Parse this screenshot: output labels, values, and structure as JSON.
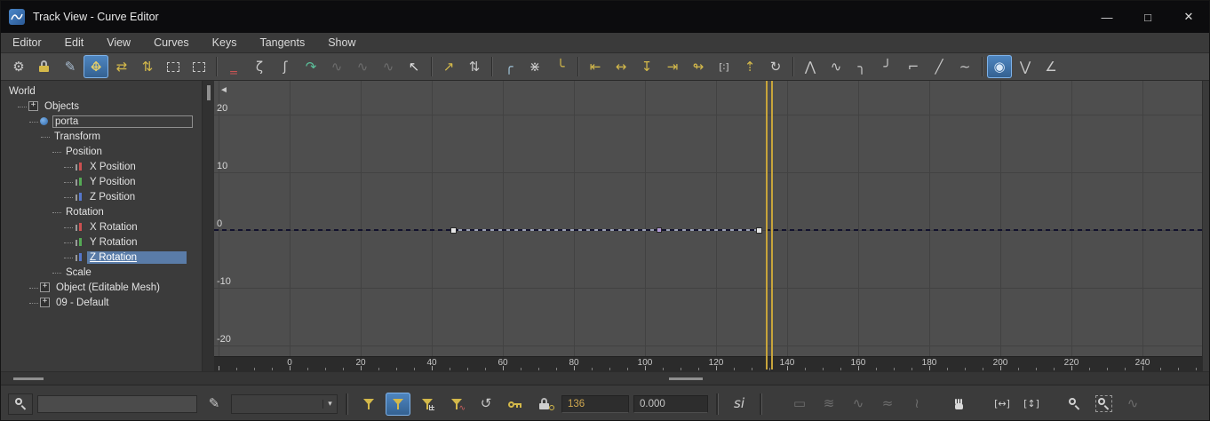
{
  "window": {
    "title": "Track View - Curve Editor",
    "controls": {
      "minimize": "—",
      "maximize": "□",
      "close": "✕"
    }
  },
  "menubar": {
    "items": [
      "Editor",
      "Edit",
      "View",
      "Curves",
      "Keys",
      "Tangents",
      "Show"
    ]
  },
  "toolbar": {
    "buttons": [
      {
        "name": "filters-icon",
        "glyph": "⚙",
        "color": "#c9c9c9"
      },
      {
        "name": "lock-selection-icon",
        "icon": "lock"
      },
      {
        "name": "draw-curves-icon",
        "glyph": "✎",
        "color": "#a9bdd1"
      },
      {
        "name": "move-keys-icon",
        "glyph": "↔",
        "glyph2": "↕",
        "color": "#e6d06a",
        "active": true
      },
      {
        "name": "move-keys-horizontal-icon",
        "glyph": "⇄",
        "color": "#d4b94a"
      },
      {
        "name": "move-keys-vertical-icon",
        "glyph": "⇅",
        "color": "#d4b94a"
      },
      {
        "name": "retime-tool-icon",
        "icon": "dashedbox"
      },
      {
        "name": "region-keys-tool-icon",
        "icon": "dashedbox"
      },
      {
        "sep": true
      },
      {
        "name": "reduce-keys-icon",
        "glyph": "‗",
        "color": "#c85454"
      },
      {
        "name": "spring-utility-icon",
        "glyph": "ζ",
        "color": "#c9c9c9"
      },
      {
        "name": "damper-utility-icon",
        "glyph": "ʃ",
        "color": "#c9c9c9"
      },
      {
        "name": "simplify-curve-icon",
        "glyph": "↷",
        "color": "#5bbf9a"
      },
      {
        "name": "show-buffer-curves-icon",
        "glyph": "∿",
        "disabled": true
      },
      {
        "name": "swap-buffer-curves-icon",
        "glyph": "∿",
        "disabled": true
      },
      {
        "name": "revert-buffer-curves-icon",
        "glyph": "∿",
        "disabled": true
      },
      {
        "name": "select-keys-cursor-icon",
        "glyph": "↖",
        "color": "#e0e0e0"
      },
      {
        "sep": true
      },
      {
        "name": "move-selected-keys-icon",
        "glyph": "↗",
        "color": "#d4b94a"
      },
      {
        "name": "nudge-keys-icon",
        "glyph": "⇅",
        "color": "#c9c9c9"
      },
      {
        "sep": true
      },
      {
        "name": "ease-tangent-icon",
        "glyph": "╭",
        "color": "#9fc3d8"
      },
      {
        "name": "break-tangents-icon",
        "glyph": "⋇",
        "color": "#c9c9c9"
      },
      {
        "name": "unify-tangents-icon",
        "glyph": "╰",
        "color": "#d4b94a"
      },
      {
        "sep": true
      },
      {
        "name": "align-keys-start-icon",
        "glyph": "⇤",
        "color": "#d4b94a"
      },
      {
        "name": "stretch-keys-icon",
        "glyph": "↔",
        "color": "#d4b94a"
      },
      {
        "name": "flatten-keys-icon",
        "glyph": "↧",
        "color": "#d4b94a"
      },
      {
        "name": "space-keys-icon",
        "glyph": "⇥",
        "color": "#d4b94a"
      },
      {
        "name": "offset-keys-icon",
        "glyph": "↬",
        "color": "#d4b94a"
      },
      {
        "name": "snap-frames-icon",
        "glyph": "[∶]",
        "color": "#c9c9c9",
        "small": true
      },
      {
        "name": "lift-keys-icon",
        "glyph": "⇡",
        "color": "#d4b94a"
      },
      {
        "name": "cycle-keys-icon",
        "glyph": "↻",
        "color": "#c9c9c9"
      },
      {
        "sep": true
      },
      {
        "name": "set-tangents-auto-icon",
        "glyph": "⋀",
        "color": "#c9c9c9"
      },
      {
        "name": "set-tangents-spline-icon",
        "glyph": "∿",
        "color": "#c9c9c9"
      },
      {
        "name": "set-tangents-fast-icon",
        "glyph": "╮",
        "color": "#c9c9c9"
      },
      {
        "name": "set-tangents-slow-icon",
        "glyph": "╯",
        "color": "#c9c9c9"
      },
      {
        "name": "set-tangents-step-icon",
        "glyph": "⌐",
        "color": "#c9c9c9"
      },
      {
        "name": "set-tangents-linear-icon",
        "glyph": "╱",
        "color": "#c9c9c9"
      },
      {
        "name": "set-tangents-smooth-icon",
        "glyph": "∼",
        "color": "#c9c9c9"
      },
      {
        "sep": true
      },
      {
        "name": "interactive-update-toggle-icon",
        "glyph": "◉",
        "color": "#d7e7f7",
        "active": true
      },
      {
        "name": "show-tangents-icon",
        "glyph": "⋁",
        "color": "#c9c9c9"
      },
      {
        "name": "show-end-tangents-icon",
        "glyph": "∠",
        "color": "#c9c9c9"
      }
    ]
  },
  "tree": {
    "axis_colors": {
      "x": "#cc5050",
      "y": "#55aa55",
      "z": "#5577cc"
    },
    "items": [
      {
        "label": "World",
        "depth": 0
      },
      {
        "label": "Objects",
        "depth": 1,
        "expander": true
      },
      {
        "label": "porta",
        "depth": 2,
        "dot": true,
        "boxed": true
      },
      {
        "label": "Transform",
        "depth": 3
      },
      {
        "label": "Position",
        "depth": 4
      },
      {
        "label": "X Position",
        "depth": 5,
        "axis": "x"
      },
      {
        "label": "Y Position",
        "depth": 5,
        "axis": "y"
      },
      {
        "label": "Z Position",
        "depth": 5,
        "axis": "z"
      },
      {
        "label": "Rotation",
        "depth": 4
      },
      {
        "label": "X Rotation",
        "depth": 5,
        "axis": "x"
      },
      {
        "label": "Y Rotation",
        "depth": 5,
        "axis": "y"
      },
      {
        "label": "Z Rotation",
        "depth": 5,
        "axis": "z",
        "selected": true
      },
      {
        "label": "Scale",
        "depth": 4
      },
      {
        "label": "Object (Editable Mesh)",
        "depth": 2,
        "expander": true
      },
      {
        "label": "09 - Default",
        "depth": 2,
        "expander": true
      }
    ]
  },
  "graph": {
    "collapse_arrow": "◄",
    "y_ticks": [
      20,
      10,
      0,
      -10,
      -20
    ],
    "x_ticks": [
      0,
      20,
      40,
      60,
      80,
      100,
      120,
      140,
      160,
      180,
      200,
      220,
      240
    ],
    "time_slider_frame": 136,
    "selected_track": "Z Rotation",
    "curve": {
      "style": "dashed",
      "color": "#12122e",
      "value": 0,
      "keys": [
        {
          "frame": 46,
          "value": 0,
          "state": "unselected"
        },
        {
          "frame": 104,
          "value": 0,
          "state": "soft"
        },
        {
          "frame": 132,
          "value": 0,
          "state": "unselected"
        }
      ]
    }
  },
  "bottombar": {
    "items": [
      {
        "type": "iconbox",
        "name": "zoom-selected-object-button",
        "icon": "magnifier"
      },
      {
        "type": "input",
        "name": "track-filter-input",
        "value": "",
        "width": 168
      },
      {
        "type": "icon",
        "name": "edit-track-set-icon",
        "glyph": "✎",
        "color": "#c9c9c9"
      },
      {
        "type": "select",
        "name": "track-set-dropdown",
        "value": "",
        "width": 118
      },
      {
        "type": "sep"
      },
      {
        "type": "icon",
        "name": "filter-selected-tracks-icon",
        "icon": "funnel"
      },
      {
        "type": "icon",
        "name": "filter-selected-objects-icon",
        "icon": "funnel",
        "active": true
      },
      {
        "type": "icon",
        "name": "filter-animated-tracks-icon",
        "icon": "funnel-grid"
      },
      {
        "type": "icon",
        "name": "filter-active-tracks-icon",
        "icon": "funnel-curve"
      },
      {
        "type": "icon",
        "name": "snap-frames-icon",
        "glyph": "↺",
        "color": "#c9c9c9"
      },
      {
        "type": "icon",
        "name": "show-keyable-tracks-icon",
        "icon": "key"
      },
      {
        "type": "icon",
        "name": "lock-selected-keys-icon",
        "icon": "keylock"
      },
      {
        "type": "field",
        "name": "key-time-field",
        "value": "136",
        "width": 62,
        "text_color": "#d0a850"
      },
      {
        "type": "field",
        "name": "key-value-field",
        "value": "0.000",
        "width": 70
      },
      {
        "type": "sep"
      },
      {
        "type": "icon",
        "name": "key-stats-icon",
        "glyph": "si",
        "italic": true,
        "color": "#cfcfcf"
      },
      {
        "type": "sep"
      },
      {
        "type": "gap",
        "width": 14
      },
      {
        "type": "icon",
        "name": "select-region-tool-icon",
        "glyph": "▭",
        "disabled": true
      },
      {
        "type": "icon",
        "name": "relax-region-tool-icon",
        "glyph": "≋",
        "disabled": true
      },
      {
        "type": "icon",
        "name": "wave-region-tool-icon",
        "glyph": "∿",
        "disabled": true
      },
      {
        "type": "icon",
        "name": "noise-region-tool-icon",
        "glyph": "≈",
        "disabled": true
      },
      {
        "type": "icon",
        "name": "warp-region-tool-icon",
        "glyph": "≀",
        "disabled": true
      },
      {
        "type": "gap",
        "width": 10
      },
      {
        "type": "icon",
        "name": "pan-icon",
        "icon": "hand"
      },
      {
        "type": "gap",
        "width": 10
      },
      {
        "type": "icon",
        "name": "zoom-horizontal-extents-icon",
        "glyph": "[↔]",
        "color": "#cfcfcf",
        "small": true
      },
      {
        "type": "icon",
        "name": "zoom-value-extents-icon",
        "glyph": "[↕]",
        "color": "#cfcfcf",
        "small": true
      },
      {
        "type": "gap",
        "width": 10
      },
      {
        "type": "icon",
        "name": "zoom-mode-icon",
        "icon": "magnifier"
      },
      {
        "type": "icon",
        "name": "zoom-region-icon",
        "icon": "magnifier-region"
      },
      {
        "type": "icon",
        "name": "isolate-curve-icon",
        "glyph": "∿",
        "disabled": true
      }
    ]
  },
  "colors": {
    "accent_yellow": "#d4b94a",
    "selection_blue": "#5a7ca8",
    "time_slider": "#c7a43b",
    "active_button": "#4f87c2"
  }
}
